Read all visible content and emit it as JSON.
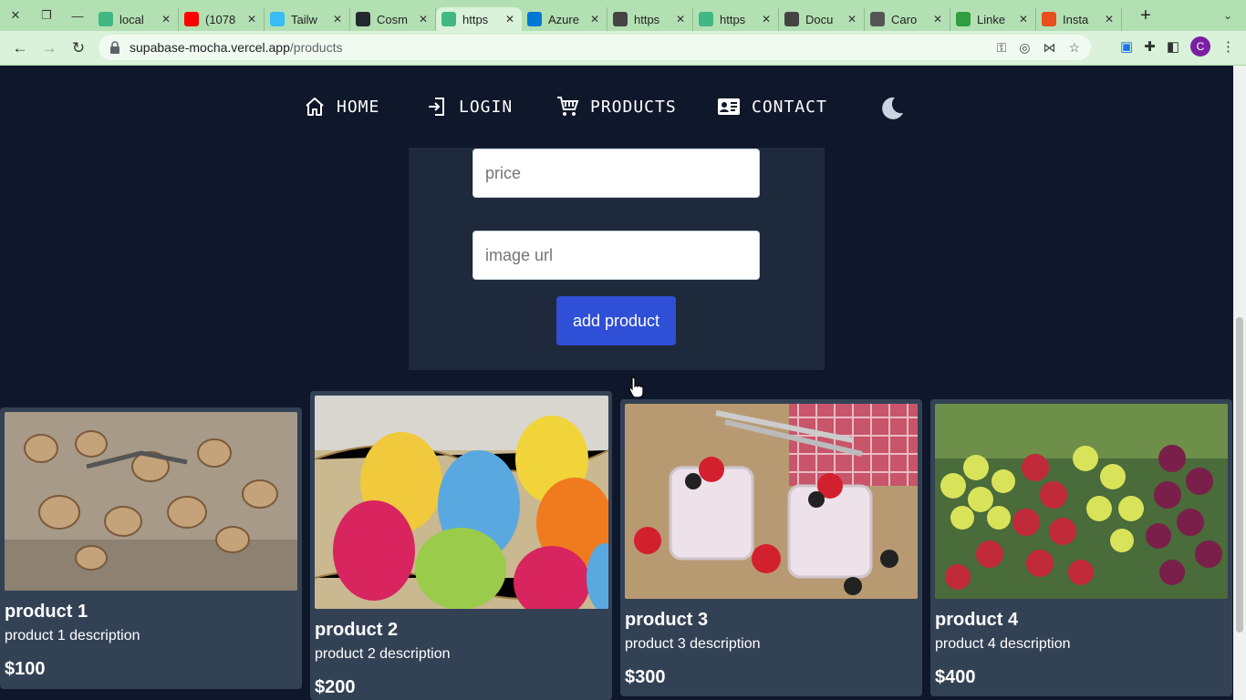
{
  "browser": {
    "tabs": [
      {
        "title": "local",
        "favicon": "vue-icon",
        "color": "#41b883"
      },
      {
        "title": "(1078",
        "favicon": "youtube-icon",
        "color": "#ff0000"
      },
      {
        "title": "Tailw",
        "favicon": "tailwind-icon",
        "color": "#38bdf8"
      },
      {
        "title": "Cosm",
        "favicon": "github-icon",
        "color": "#24292f"
      },
      {
        "title": "https",
        "favicon": "vue-icon",
        "color": "#41b883"
      },
      {
        "title": "Azure",
        "favicon": "azure-icon",
        "color": "#0078d4"
      },
      {
        "title": "https",
        "favicon": "globe-icon",
        "color": "#444"
      },
      {
        "title": "https",
        "favicon": "vue-icon",
        "color": "#41b883"
      },
      {
        "title": "Docu",
        "favicon": "globe-icon",
        "color": "#444"
      },
      {
        "title": "Caro",
        "favicon": "openai-icon",
        "color": "#555"
      },
      {
        "title": "Linke",
        "favicon": "linkedin-icon",
        "color": "#2e9e3e"
      },
      {
        "title": "Insta",
        "favicon": "install-icon",
        "color": "#e94e1b"
      }
    ],
    "url_host": "supabase-mocha.vercel.app",
    "url_path": "/products",
    "profile_initial": "C"
  },
  "nav": {
    "home": "HOME",
    "login": "LOGIN",
    "products": "PRODUCTS",
    "contact": "CONTACT"
  },
  "form": {
    "price_placeholder": "price",
    "image_placeholder": "image url",
    "add_label": "add product"
  },
  "products": [
    {
      "name": "product 1",
      "description": "product 1 description",
      "price": "$100",
      "image": "walnuts"
    },
    {
      "name": "product 2",
      "description": "product 2 description",
      "price": "$200",
      "image": "easter eggs"
    },
    {
      "name": "product 3",
      "description": "product 3 description",
      "price": "$300",
      "image": "berry yogurt"
    },
    {
      "name": "product 4",
      "description": "product 4 description",
      "price": "$400",
      "image": "grapes"
    }
  ],
  "colors": {
    "accent": "#2f4fd6",
    "page_bg": "#0f172a",
    "panel_bg": "#1e293b",
    "card_bg": "#334155",
    "chrome_green": "#b3e0b3"
  }
}
